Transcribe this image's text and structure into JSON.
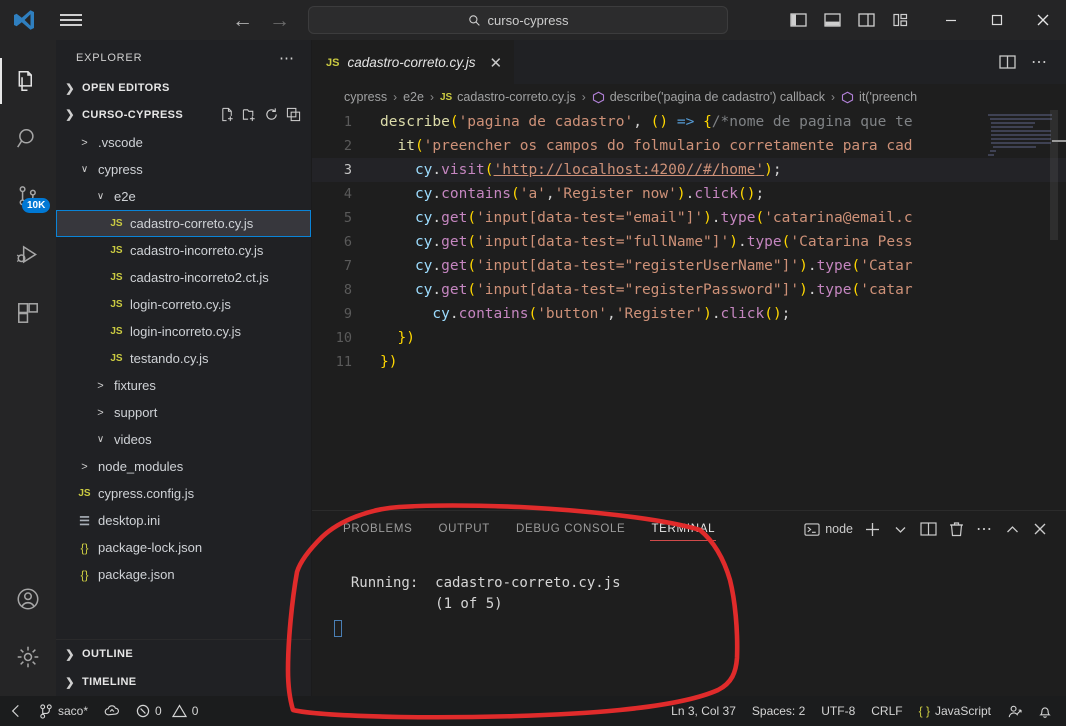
{
  "titlebar": {
    "logo_icon": "vscode-logo-icon",
    "menu_icon": "hamburger-menu-icon",
    "back_icon": "back-arrow-icon",
    "forward_icon": "forward-arrow-icon",
    "search": {
      "icon": "search-icon",
      "value": "curso-cypress",
      "placeholder": "Search"
    },
    "layout_icons": [
      "toggle-primary-sidebar-icon",
      "toggle-panel-icon",
      "toggle-secondary-sidebar-icon",
      "customize-layout-icon"
    ],
    "window_controls": {
      "minimize": "—",
      "maximize": "□",
      "close": "✕"
    }
  },
  "activitybar": {
    "items": [
      {
        "name": "explorer",
        "icon": "files-icon",
        "active": true,
        "badge": ""
      },
      {
        "name": "search",
        "icon": "search-icon",
        "active": false,
        "badge": ""
      },
      {
        "name": "source-control",
        "icon": "source-control-icon",
        "active": false,
        "badge": "10K"
      },
      {
        "name": "run-and-debug",
        "icon": "run-debug-icon",
        "active": false,
        "badge": ""
      },
      {
        "name": "extensions",
        "icon": "extensions-icon",
        "active": false,
        "badge": ""
      }
    ],
    "bottom": [
      {
        "name": "accounts",
        "icon": "account-icon"
      },
      {
        "name": "manage",
        "icon": "gear-icon"
      }
    ]
  },
  "sidebar": {
    "title": "EXPLORER",
    "more_icon": "more-actions-icon",
    "open_editors": {
      "label": "OPEN EDITORS",
      "expanded": false
    },
    "project": {
      "label": "CURSO-CYPRESS",
      "expanded": true,
      "actions": [
        "new-file-icon",
        "new-folder-icon",
        "refresh-icon",
        "collapse-all-icon"
      ]
    },
    "tree": [
      {
        "label": ".vscode",
        "type": "folder",
        "expanded": false,
        "indent": 1
      },
      {
        "label": "cypress",
        "type": "folder",
        "expanded": true,
        "indent": 1
      },
      {
        "label": "e2e",
        "type": "folder",
        "expanded": true,
        "indent": 2
      },
      {
        "label": "cadastro-correto.cy.js",
        "type": "js",
        "indent": 3,
        "selected": true
      },
      {
        "label": "cadastro-incorreto.cy.js",
        "type": "js",
        "indent": 3
      },
      {
        "label": "cadastro-incorreto2.ct.js",
        "type": "js",
        "indent": 3
      },
      {
        "label": "login-correto.cy.js",
        "type": "js",
        "indent": 3
      },
      {
        "label": "login-incorreto.cy.js",
        "type": "js",
        "indent": 3
      },
      {
        "label": "testando.cy.js",
        "type": "js",
        "indent": 3
      },
      {
        "label": "fixtures",
        "type": "folder",
        "expanded": false,
        "indent": 2
      },
      {
        "label": "support",
        "type": "folder",
        "expanded": false,
        "indent": 2
      },
      {
        "label": "videos",
        "type": "folder",
        "expanded": true,
        "indent": 2
      },
      {
        "label": "node_modules",
        "type": "folder",
        "expanded": false,
        "indent": 1
      },
      {
        "label": "cypress.config.js",
        "type": "js",
        "indent": 1
      },
      {
        "label": "desktop.ini",
        "type": "ini",
        "indent": 1
      },
      {
        "label": "package-lock.json",
        "type": "json",
        "indent": 1
      },
      {
        "label": "package.json",
        "type": "json",
        "indent": 1
      }
    ],
    "bottom_sections": [
      {
        "label": "OUTLINE",
        "expanded": false
      },
      {
        "label": "TIMELINE",
        "expanded": false
      }
    ]
  },
  "editor": {
    "tab": {
      "label": "cadastro-correto.cy.js",
      "icon": "js-file-icon",
      "close_icon": "close-icon",
      "active": true
    },
    "tab_actions": [
      "split-editor-icon",
      "more-actions-icon"
    ],
    "breadcrumb": [
      {
        "label": "cypress",
        "icon": ""
      },
      {
        "label": "e2e",
        "icon": ""
      },
      {
        "label": "cadastro-correto.cy.js",
        "icon": "js-file-icon"
      },
      {
        "label": "describe('pagina de cadastro') callback",
        "icon": "symbol-method-icon"
      },
      {
        "label": "it('preench",
        "icon": "symbol-method-icon"
      }
    ],
    "active_line": 3,
    "lines": [
      {
        "n": 1,
        "text": "describe('pagina de cadastro', () => {/*nome de pagina que te"
      },
      {
        "n": 2,
        "text": "  it('preencher os campos do folmulario corretamente para cad"
      },
      {
        "n": 3,
        "text": "    cy.visit('http://localhost:4200//#/home');"
      },
      {
        "n": 4,
        "text": "    cy.contains('a','Register now').click();"
      },
      {
        "n": 5,
        "text": "    cy.get('input[data-test=\"email\"]').type('catarina@email.c"
      },
      {
        "n": 6,
        "text": "    cy.get('input[data-test=\"fullName\"]').type('Catarina Pess"
      },
      {
        "n": 7,
        "text": "    cy.get('input[data-test=\"registerUserName\"]').type('Catar"
      },
      {
        "n": 8,
        "text": "    cy.get('input[data-test=\"registerPassword\"]').type('catar"
      },
      {
        "n": 9,
        "text": "      cy.contains('button','Register').click();"
      },
      {
        "n": 10,
        "text": "  })"
      },
      {
        "n": 11,
        "text": "})"
      }
    ]
  },
  "panel": {
    "tabs": [
      {
        "label": "PROBLEMS",
        "active": false
      },
      {
        "label": "OUTPUT",
        "active": false
      },
      {
        "label": "DEBUG CONSOLE",
        "active": false
      },
      {
        "label": "TERMINAL",
        "active": true
      }
    ],
    "actions": {
      "shell_label": "node",
      "shell_icon": "terminal-icon",
      "new_terminal_icon": "plus-icon",
      "dropdown_icon": "chevron-down-icon",
      "split_icon": "split-terminal-icon",
      "kill_icon": "trash-icon",
      "more_icon": "more-actions-icon",
      "maximize_icon": "chevron-up-icon",
      "close_icon": "close-icon"
    },
    "terminal_output": [
      "  Running:  cadastro-correto.cy.js",
      "            (1 of 5)"
    ]
  },
  "statusbar": {
    "left": [
      {
        "name": "remote",
        "icon": "remote-window-icon",
        "label": ""
      },
      {
        "name": "branch",
        "icon": "source-control-branch-icon",
        "label": "saco*"
      },
      {
        "name": "sync",
        "icon": "sync-cloud-icon",
        "label": ""
      },
      {
        "name": "errors",
        "icon": "error-icon",
        "label": "0"
      },
      {
        "name": "warnings",
        "icon": "warning-icon",
        "label": "0"
      }
    ],
    "right": [
      {
        "name": "cursor-position",
        "label": "Ln 3, Col 37"
      },
      {
        "name": "indentation",
        "label": "Spaces: 2"
      },
      {
        "name": "encoding",
        "label": "UTF-8"
      },
      {
        "name": "eol",
        "label": "CRLF"
      },
      {
        "name": "language-mode",
        "label": "JavaScript",
        "icon": "json-brackets-icon"
      },
      {
        "name": "feedback",
        "icon": "feedback-icon",
        "label": ""
      },
      {
        "name": "notifications",
        "icon": "bell-icon",
        "label": ""
      }
    ]
  },
  "annotation": {
    "color": "#e02b2b",
    "shape": "freehand-oval-around-terminal"
  },
  "colors": {
    "accent": "#0078d4",
    "annotation_red": "#e02b2b",
    "editor_bg": "#1e1e1e",
    "sidebar_bg": "#202124",
    "statusbar_bg": "#1b1c1d"
  }
}
